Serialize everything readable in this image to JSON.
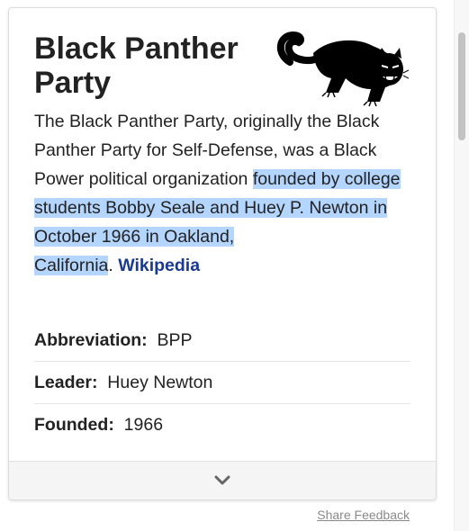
{
  "card": {
    "title": "Black Panther Party",
    "logo": "black-panther-logo",
    "description": {
      "plain": "The Black Panther Party, originally the Black Panther Party for Self-Defense, was a Black Power political organization ",
      "highlighted_1": "founded by college students Bobby Seale and Huey P. Newton in October 1966 in Oakland,",
      "highlighted_2": "California",
      "end": ". ",
      "link": "Wikipedia"
    },
    "facts": [
      {
        "label": "Abbreviation:",
        "value": "BPP"
      },
      {
        "label": "Leader:",
        "value": "Huey Newton"
      },
      {
        "label": "Founded:",
        "value": "1966"
      }
    ]
  },
  "footer": {
    "feedback": "Share Feedback"
  },
  "colors": {
    "highlight": "#b4d5fe",
    "link": "#1a3a8f"
  }
}
